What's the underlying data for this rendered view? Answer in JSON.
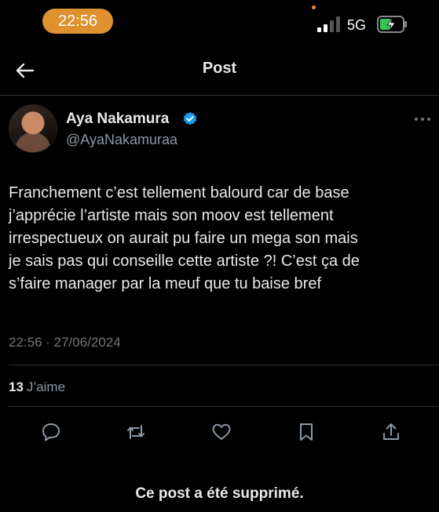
{
  "status_bar": {
    "time": "22:56",
    "network": "5G",
    "accent_color": "#e0912f"
  },
  "header": {
    "title": "Post",
    "back_icon": "arrow-left-icon"
  },
  "post": {
    "author_name": "Aya Nakamura",
    "author_handle": "@AyaNakamuraa",
    "verified": true,
    "text": "Franchement c’est tellement balourd car de base\nj’apprécie l’artiste mais son moov est tellement\nirrespectueux on aurait pu faire un mega son mais\nje sais pas qui conseille cette artiste ?! C’est ça de\ns’faire manager par la meuf que tu baise bref",
    "timestamp": "22:56 · 27/06/2024",
    "like_count": "13",
    "like_label": "J’aime"
  },
  "actions": [
    {
      "name": "reply",
      "icon": "comment-icon"
    },
    {
      "name": "repost",
      "icon": "repost-icon"
    },
    {
      "name": "like",
      "icon": "heart-icon"
    },
    {
      "name": "bookmark",
      "icon": "bookmark-icon"
    },
    {
      "name": "share",
      "icon": "share-icon"
    }
  ],
  "notice": "Ce post a été supprimé.",
  "colors": {
    "background": "#000000",
    "text": "#e7e9ea",
    "muted": "#71767b",
    "verified": "#1d9bf0"
  }
}
